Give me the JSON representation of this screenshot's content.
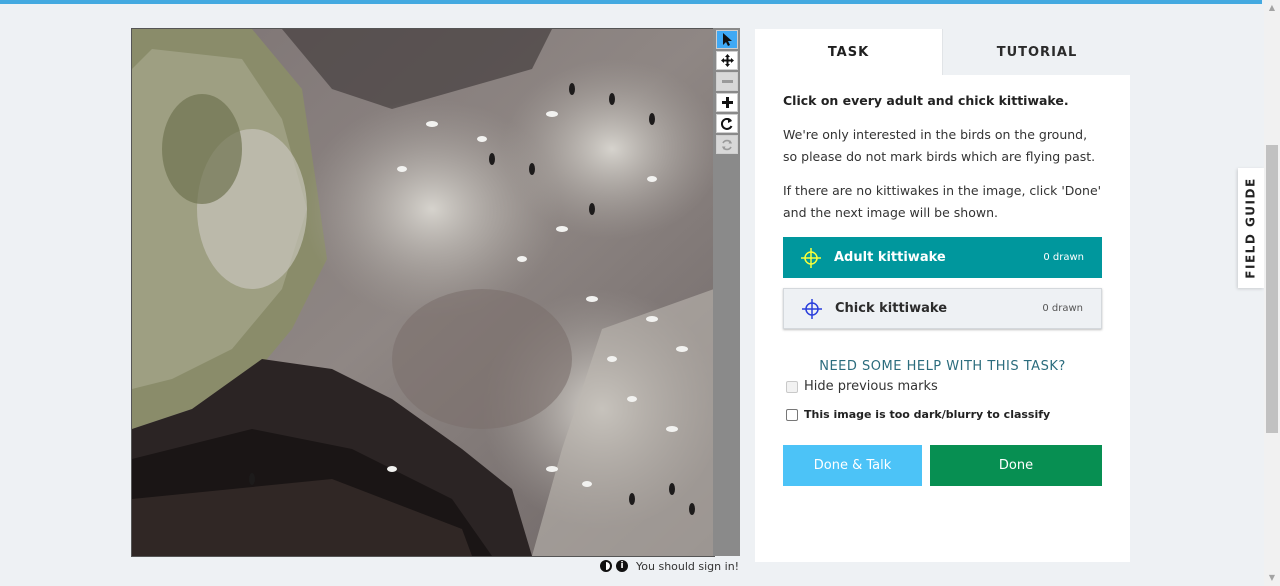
{
  "toolbar": {
    "tools": [
      {
        "name": "pointer",
        "icon": "cursor-icon",
        "state": "active"
      },
      {
        "name": "pan",
        "icon": "move-icon",
        "state": "normal"
      },
      {
        "name": "zoom-out",
        "icon": "minus-icon",
        "state": "disabled"
      },
      {
        "name": "zoom-in",
        "icon": "plus-icon",
        "state": "normal"
      },
      {
        "name": "rotate",
        "icon": "rotate-icon",
        "state": "normal"
      },
      {
        "name": "reset",
        "icon": "refresh-icon",
        "state": "disabled"
      }
    ]
  },
  "viewer_footer": {
    "sign_in_text": "You should sign in!",
    "icons": [
      "contrast-icon",
      "info-icon"
    ]
  },
  "tabs": {
    "task": "TASK",
    "tutorial": "TUTORIAL"
  },
  "task": {
    "title": "Click on every adult and chick kittiwake.",
    "para1": "We're only interested in the birds on the ground, so please do not mark birds which are flying past.",
    "para2": "If there are no kittiwakes in the image, click 'Done' and the next image will be shown.",
    "tools": [
      {
        "label": "Adult kittiwake",
        "count": "0 drawn",
        "color": "#f7ff3a",
        "selected": true
      },
      {
        "label": "Chick kittiwake",
        "count": "0 drawn",
        "color": "#2a3fdc",
        "selected": false
      }
    ],
    "help_link": "NEED SOME HELP WITH THIS TASK?",
    "hide_marks": "Hide previous marks",
    "too_dark": "This image is too dark/blurry to classify"
  },
  "buttons": {
    "done_talk": "Done & Talk",
    "done": "Done"
  },
  "field_guide": "FIELD GUIDE",
  "colors": {
    "accent_top": "#43a9e0",
    "selected_tool": "#00979d",
    "done_talk": "#4cc3f7",
    "done": "#078f52"
  }
}
